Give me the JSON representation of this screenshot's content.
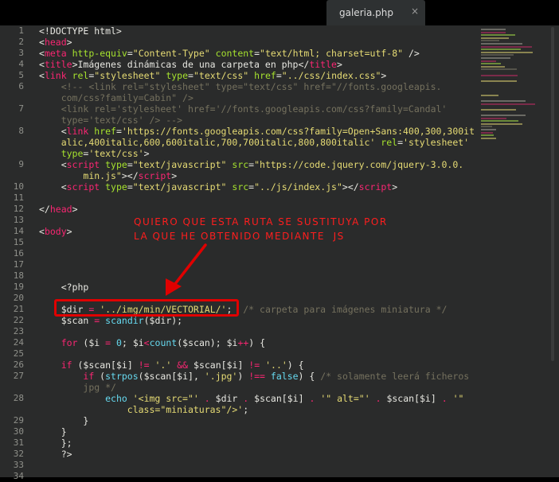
{
  "tab": {
    "title": "galeria.php",
    "close_glyph": "×"
  },
  "code_lines": [
    {
      "n": "1",
      "html": "&lt;!DOCTYPE html&gt;"
    },
    {
      "n": "2",
      "html": "<span class='p'>&lt;</span><span class='t'>head</span><span class='p'>&gt;</span>"
    },
    {
      "n": "3",
      "html": "<span class='p'>&lt;</span><span class='t'>meta</span> <span class='a'>http-equiv</span>=<span class='s'>\"Content-Type\"</span> <span class='a'>content</span>=<span class='s'>\"text/html; charset=utf-8\"</span> /&gt;"
    },
    {
      "n": "4",
      "html": "<span class='p'>&lt;</span><span class='t'>title</span><span class='p'>&gt;</span>Imágenes dinámicas de una carpeta en php<span class='p'>&lt;/</span><span class='t'>title</span><span class='p'>&gt;</span>"
    },
    {
      "n": "5",
      "html": "<span class='p'>&lt;</span><span class='t'>link</span> <span class='a'>rel</span>=<span class='s'>\"stylesheet\"</span> <span class='a'>type</span>=<span class='s'>\"text/css\"</span> <span class='a'>href</span>=<span class='s'>\"../css/index.css\"</span>&gt;"
    },
    {
      "n": "6",
      "html": "    <span class='c'>&lt;!-- &lt;link rel=\"stylesheet\" type=\"text/css\" href=\"//fonts.googleapis.</span>"
    },
    {
      "n": "",
      "html": "    <span class='c'>com/css?family=Cabin\" /&gt;</span>"
    },
    {
      "n": "7",
      "html": "    <span class='c'>&lt;link rel='stylesheet' href='//fonts.googleapis.com/css?family=Candal'</span>"
    },
    {
      "n": "",
      "html": "    <span class='c'>type='text/css' /&gt; --&gt;</span>"
    },
    {
      "n": "8",
      "html": "    &lt;<span class='t'>link</span> <span class='a'>href</span>=<span class='s'>'https://fonts.googleapis.com/css?family=Open+Sans:400,300,300it</span>"
    },
    {
      "n": "",
      "html": "    <span class='s'>alic,400italic,600,600italic,700,700italic,800,800italic'</span> <span class='a'>rel</span>=<span class='s'>'stylesheet'</span>"
    },
    {
      "n": "",
      "html": "    <span class='a'>type</span>=<span class='s'>'text/css'</span>&gt;"
    },
    {
      "n": "9",
      "html": "    &lt;<span class='t'>script</span> <span class='a'>type</span>=<span class='s'>\"text/javascript\"</span> <span class='a'>src</span>=<span class='s'>\"https://code.jquery.com/jquery-3.0.0.</span>"
    },
    {
      "n": "",
      "html": "        <span class='s'>min.js\"</span>&gt;&lt;/<span class='t'>script</span>&gt;"
    },
    {
      "n": "10",
      "html": "    &lt;<span class='t'>script</span> <span class='a'>type</span>=<span class='s'>\"text/javascript\"</span> <span class='a'>src</span>=<span class='s'>\"../js/index.js\"</span>&gt;&lt;/<span class='t'>script</span>&gt;"
    },
    {
      "n": "11",
      "html": ""
    },
    {
      "n": "12",
      "html": "&lt;/<span class='t'>head</span>&gt;"
    },
    {
      "n": "13",
      "html": ""
    },
    {
      "n": "14",
      "html": "&lt;<span class='t'>body</span>&gt;"
    },
    {
      "n": "15",
      "html": ""
    },
    {
      "n": "16",
      "html": ""
    },
    {
      "n": "17",
      "html": ""
    },
    {
      "n": "18",
      "html": ""
    },
    {
      "n": "19",
      "html": "    &lt;?php"
    },
    {
      "n": "20",
      "html": ""
    },
    {
      "n": "21",
      "html": "    <span class='v'>$dir</span> <span class='k'>=</span> <span class='s'>'../img/min/VECTORIAL/'</span>;  <span class='c'>/* carpeta para imágenes miniatura */</span>"
    },
    {
      "n": "22",
      "html": "    <span class='v'>$scan</span> <span class='k'>=</span> <span class='f'>scandir</span>(<span class='v'>$dir</span>);"
    },
    {
      "n": "23",
      "html": ""
    },
    {
      "n": "24",
      "html": "    <span class='k'>for</span> (<span class='v'>$i</span> <span class='k'>=</span> <span class='f'>0</span>; <span class='v'>$i</span><span class='k'>&lt;</span><span class='f'>count</span>(<span class='v'>$scan</span>); <span class='v'>$i</span><span class='k'>++</span>) {"
    },
    {
      "n": "25",
      "html": ""
    },
    {
      "n": "26",
      "html": "    <span class='k'>if</span> (<span class='v'>$scan</span>[<span class='v'>$i</span>] <span class='k'>!=</span> <span class='s'>'.'</span> <span class='k'>&amp;&amp;</span> <span class='v'>$scan</span>[<span class='v'>$i</span>] <span class='k'>!=</span> <span class='s'>'..'</span>) {"
    },
    {
      "n": "27",
      "html": "        <span class='k'>if</span> (<span class='f'>strpos</span>(<span class='v'>$scan</span>[<span class='v'>$i</span>], <span class='s'>'.jpg'</span>) <span class='k'>!==</span> <span class='f'>false</span>) { <span class='c'>/* solamente leerá ficheros</span>"
    },
    {
      "n": "",
      "html": "        <span class='c'>jpg */</span>"
    },
    {
      "n": "28",
      "html": "            <span class='f'>echo</span> <span class='s'>'&lt;img src=\"'</span> <span class='k'>.</span> <span class='v'>$dir</span> <span class='k'>.</span> <span class='v'>$scan</span>[<span class='v'>$i</span>] <span class='k'>.</span> <span class='s'>'\" alt=\"'</span> <span class='k'>.</span> <span class='v'>$scan</span>[<span class='v'>$i</span>] <span class='k'>.</span> <span class='s'>'\"</span>"
    },
    {
      "n": "",
      "html": "                <span class='s'>class=\"miniaturas\"/&gt;'</span>;"
    },
    {
      "n": "29",
      "html": "        }"
    },
    {
      "n": "30",
      "html": "    }"
    },
    {
      "n": "31",
      "html": "    };"
    },
    {
      "n": "32",
      "html": "    ?&gt;"
    },
    {
      "n": "33",
      "html": ""
    },
    {
      "n": "34",
      "html": ""
    }
  ],
  "annotation": {
    "line1": "QUIERO QUE ESTA RUTA SE SUSTITUYA POR",
    "line2": "LA QUE HE OBTENIDO MEDIANTE  JS",
    "color": "#ff1e1e"
  },
  "colors": {
    "background": "#2a2b2b",
    "tag": "#f92672",
    "attribute": "#a6e22e",
    "string": "#e6db74",
    "comment": "#75715e",
    "function": "#66d9ef"
  }
}
